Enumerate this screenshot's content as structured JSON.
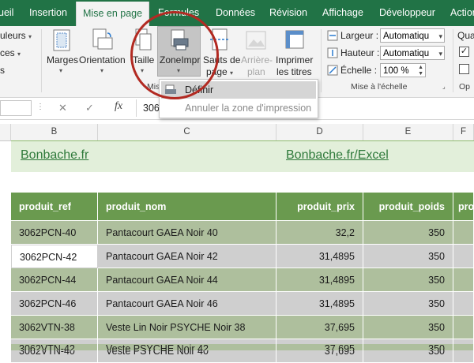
{
  "tabs": [
    {
      "label": "ueil"
    },
    {
      "label": "Insertion"
    },
    {
      "label": "Mise en page"
    },
    {
      "label": "Formules"
    },
    {
      "label": "Données"
    },
    {
      "label": "Révision"
    },
    {
      "label": "Affichage"
    },
    {
      "label": "Développeur"
    },
    {
      "label": "Action"
    }
  ],
  "ribbon": {
    "left_partial": [
      "uleurs",
      "ces",
      "s"
    ],
    "marges": "Marges",
    "orientation": "Orientation",
    "taille": "Taille",
    "zone_impr": "ZoneImpr",
    "sauts_line1": "Sauts de",
    "sauts_line2": "page",
    "arriere_line1": "Arrière-",
    "arriere_line2": "plan",
    "imprimer_line1": "Imprimer",
    "imprimer_line2": "les titres",
    "group_partial": "Mis",
    "largeur_label": "Largeur :",
    "largeur_value": "Automatiqu",
    "hauteur_label": "Hauteur :",
    "hauteur_value": "Automatiqu",
    "echelle_label": "Échelle :",
    "echelle_value": "100 %",
    "group_scale": "Mise à l'échelle",
    "right_partial_1": "Qua",
    "right_partial_2": "Op"
  },
  "formula_bar": {
    "cancel": "✕",
    "confirm": "✓",
    "fx": "fx",
    "value": "306"
  },
  "dropdown": {
    "item1": "Définir",
    "item2": "Annuler la zone d'impression"
  },
  "columns": [
    "B",
    "C",
    "D",
    "E",
    "F"
  ],
  "banner": {
    "left_link": "Bonbache.fr",
    "right_link": "Bonbache.fr/Excel"
  },
  "table": {
    "headers": [
      "produit_ref",
      "produit_nom",
      "produit_prix",
      "produit_poids",
      "pro"
    ],
    "rows": [
      [
        "3062PCN-40",
        "Pantacourt GAEA Noir 40",
        "32,2",
        "350"
      ],
      [
        "3062PCN-42",
        "Pantacourt GAEA Noir 42",
        "31,4895",
        "350"
      ],
      [
        "3062PCN-44",
        "Pantacourt GAEA Noir 44",
        "31,4895",
        "350"
      ],
      [
        "3062PCN-46",
        "Pantacourt GAEA Noir 46",
        "31,4895",
        "350"
      ],
      [
        "3062VTN-38",
        "Veste Lin Noir PSYCHE Noir 38",
        "37,695",
        "350"
      ],
      [
        "3062VTN-40",
        "Veste PSYCHE Noir 40",
        "37,695",
        "350"
      ],
      [
        "3062VTN-42",
        "Veste PSYCHE Noir 42",
        "37,695",
        "350"
      ]
    ]
  },
  "colors": {
    "excel_green": "#217346",
    "header_green": "#6a9a4f",
    "row_green": "#aebf9d",
    "row_gray": "#cfcfcf",
    "banner_bg": "#e2efda",
    "highlight_circle": "#b22a22"
  }
}
